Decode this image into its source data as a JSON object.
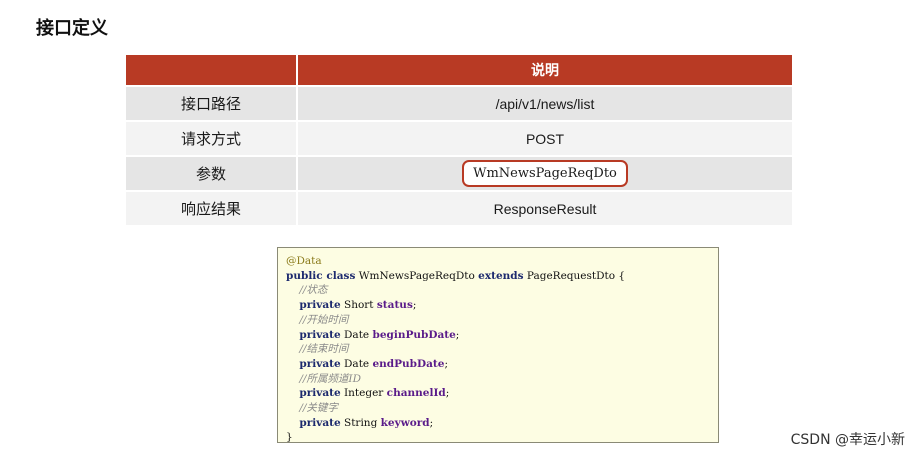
{
  "title": "接口定义",
  "table": {
    "header": [
      "",
      "说明"
    ],
    "rows": [
      {
        "key": "接口路径",
        "value": "/api/v1/news/list"
      },
      {
        "key": "请求方式",
        "value": "POST"
      },
      {
        "key": "参数",
        "value": "WmNewsPageReqDto"
      },
      {
        "key": "响应结果",
        "value": "ResponseResult"
      }
    ],
    "highlight_color": "#b83a24"
  },
  "code": {
    "annotation": "@Data",
    "class_kw": "public class",
    "class_name": "WmNewsPageReqDto",
    "extends_kw": "extends",
    "parent": "PageRequestDto {",
    "fields": [
      {
        "comment": "//状态",
        "mod": "private",
        "type": "Short",
        "name": "status"
      },
      {
        "comment": "//开始时间",
        "mod": "private",
        "type": "Date",
        "name": "beginPubDate"
      },
      {
        "comment": "//结束时间",
        "mod": "private",
        "type": "Date",
        "name": "endPubDate"
      },
      {
        "comment": "//所属频道ID",
        "mod": "private",
        "type": "Integer",
        "name": "channelId"
      },
      {
        "comment": "//关键字",
        "mod": "private",
        "type": "String",
        "name": "keyword"
      }
    ],
    "close": "}"
  },
  "watermark": "CSDN @幸运小新"
}
